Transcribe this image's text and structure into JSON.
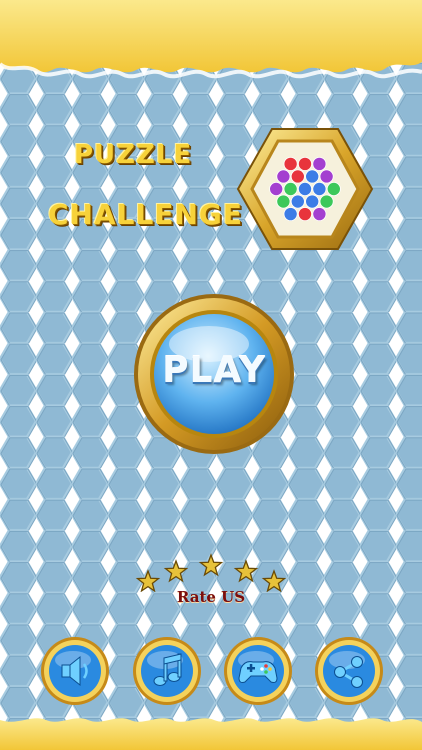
{
  "title": {
    "line1": "PUZZLE",
    "line2": "CHALLENGE"
  },
  "play": {
    "label": "PLAY"
  },
  "rating": {
    "label": "Rate US",
    "star_count": 5
  },
  "bottom_bar": [
    {
      "name": "sound-button",
      "icon": "speaker-icon"
    },
    {
      "name": "music-button",
      "icon": "music-note-icon"
    },
    {
      "name": "more-games-button",
      "icon": "gamepad-icon"
    },
    {
      "name": "share-button",
      "icon": "share-icon"
    }
  ],
  "colors": {
    "background": "#8fb9d4",
    "banner": "#f8d95a",
    "gold": "#d8a62a",
    "button_blue": "#2e8ede",
    "title_yellow": "#f7d23a"
  }
}
